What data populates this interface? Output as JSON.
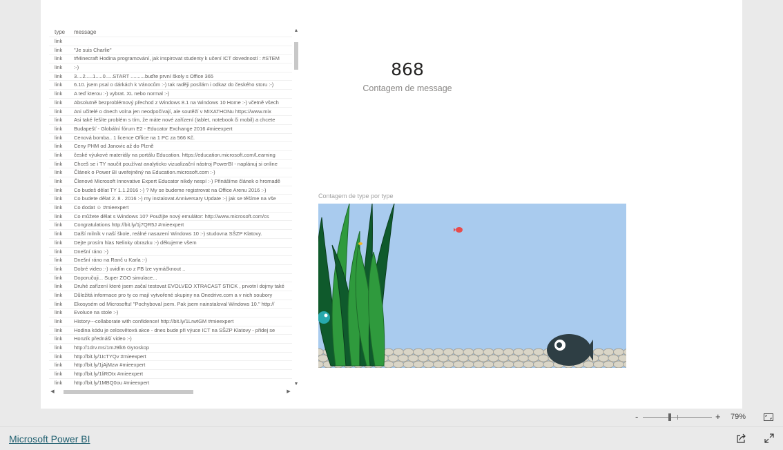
{
  "table": {
    "headers": {
      "type": "type",
      "message": "message"
    },
    "rows": [
      {
        "type": "link",
        "message": ""
      },
      {
        "type": "link",
        "message": "\"Je suis Charlie\""
      },
      {
        "type": "link",
        "message": "#Minecraft Hodina programování, jak inspirovat studenty k učení ICT dovedností : #STEM"
      },
      {
        "type": "link",
        "message": ":-)"
      },
      {
        "type": "link",
        "message": "3....2.....1.....0.....START ..........buďte první školy s Office 365"
      },
      {
        "type": "link",
        "message": "6.10. jsem psal o dárkách k Vánocům :-) tak raději posílám i odkaz do českého storu :-)"
      },
      {
        "type": "link",
        "message": "A teď kterou :-) vybrat. XL nebo normal :-)"
      },
      {
        "type": "link",
        "message": "Absolutně bezproblémový přechod z Windows 8.1 na Windows 10 Home :-) včetně všech"
      },
      {
        "type": "link",
        "message": "Ani učitelé o dnech volna jen neodpočívají, ale soutěží v MIXATHONu https://www.mix"
      },
      {
        "type": "link",
        "message": "Asi také řešíte problém s tím, že máte nové zařízení (tablet, notebook či mobil) a chcete"
      },
      {
        "type": "link",
        "message": "Budapešť - Globální fórum E2 - Educator Exchange 2016 #mieexpert"
      },
      {
        "type": "link",
        "message": "Cenová bomba.. 1 licence Office na 1 PC za 566 Kč."
      },
      {
        "type": "link",
        "message": "Ceny PHM od Janovic až do Plzně"
      },
      {
        "type": "link",
        "message": "české výukové materiály na portálu Education. https://education.microsoft.com/Learning"
      },
      {
        "type": "link",
        "message": "Chceš se i TY naučit používat analyticko vizualizační nástroj PowerBI - naplánuj si online"
      },
      {
        "type": "link",
        "message": "Článek o Power BI uveřejněný na Education.microsoft.com :-)"
      },
      {
        "type": "link",
        "message": "Členové Microsoft Innovative Expert Educator nikdy nespí :-)  Přinášíme článek o hromadě"
      },
      {
        "type": "link",
        "message": "Co budeš dělat TY 1.1.2016 :-) ? My se budeme registrovat na Office Arenu 2016 :-)"
      },
      {
        "type": "link",
        "message": "Co budete dělat 2. 8 . 2016 :-) my instalovat Anniversary Update :-) jak se těšíme na vše"
      },
      {
        "type": "link",
        "message": "Co dodat ☺ #mieexpert"
      },
      {
        "type": "link",
        "message": "Co můžete dělat s Windows 10? Použijte  nový emulátor:  http://www.microsoft.com/cs"
      },
      {
        "type": "link",
        "message": "Congratulations http://bit.ly/1j7QR5J #mieexpert"
      },
      {
        "type": "link",
        "message": "Další milník v naší škole, reálné nasazení Windows 10 :-) studovna SŠZP Klatovy."
      },
      {
        "type": "link",
        "message": "Dejte prosím hlas Nelinky obrazku :-) děkujeme všem"
      },
      {
        "type": "link",
        "message": "Dnešní ráno :-)"
      },
      {
        "type": "link",
        "message": "Dnešní ráno na Ranč u Karla :-)"
      },
      {
        "type": "link",
        "message": "Dobré video :-) uvidím co z FB lze vymáčknout .."
      },
      {
        "type": "link",
        "message": "Doporučuji... Super ZOO simulace..."
      },
      {
        "type": "link",
        "message": "Druhé zařízení které jsem začal testovat EVOLVEO XTRACAST STICK , prvotní dojmy také"
      },
      {
        "type": "link",
        "message": "Důležitá informace pro ty co mají vytvořené skupiny na Onedrive.com a v nich soubory"
      },
      {
        "type": "link",
        "message": "Ekosysém od Microsoftu! \"Pochyboval jsem. Pak jsem nainstaloval Windows 10.\" http://"
      },
      {
        "type": "link",
        "message": "Evoluce na stole :-)"
      },
      {
        "type": "link",
        "message": "History---collaborate with confidence! http://bit.ly/1LrwtGM #mieexpert"
      },
      {
        "type": "link",
        "message": "Hodina kódu je celosvětová akce - dnes bude při výuce ICT na SŠZP Klatovy - přidej se"
      },
      {
        "type": "link",
        "message": "Honzík přednáší video :-)"
      },
      {
        "type": "link",
        "message": "http://1drv.ms/1mJ9lk6 Gyroskop"
      },
      {
        "type": "link",
        "message": "http://bit.ly/1IcTYQv #mieexpert"
      },
      {
        "type": "link",
        "message": "http://bit.ly/1jAjMzw #mieexpert"
      },
      {
        "type": "link",
        "message": "http://bit.ly/1liROtx #mieexpert"
      },
      {
        "type": "link",
        "message": "http://bit.ly/1MBQ0ou #mieexpert"
      }
    ],
    "scroll": {
      "up": "▲",
      "down": "▼",
      "left": "◀",
      "right": "▶"
    }
  },
  "card": {
    "value": "868",
    "label": "Contagem de message"
  },
  "aquarium": {
    "title": "Contagem de type por type",
    "colors": {
      "water": "#a9cbee",
      "pebbles": "#d9d5c7",
      "seaweed_dark": "#0f5a2c",
      "seaweed_light": "#2f9a3d",
      "fish_big": "#2e3e44",
      "fish_teal": "#27a9ad",
      "fish_red": "#e84c4c",
      "fish_yellow": "#f1b72d"
    }
  },
  "zoom": {
    "minus": "-",
    "plus": "+",
    "level": "79%"
  },
  "footer": {
    "brand": "Microsoft Power BI"
  },
  "icons": {
    "fit": "fit-to-page-icon",
    "share": "share-icon",
    "fullscreen": "fullscreen-icon"
  }
}
